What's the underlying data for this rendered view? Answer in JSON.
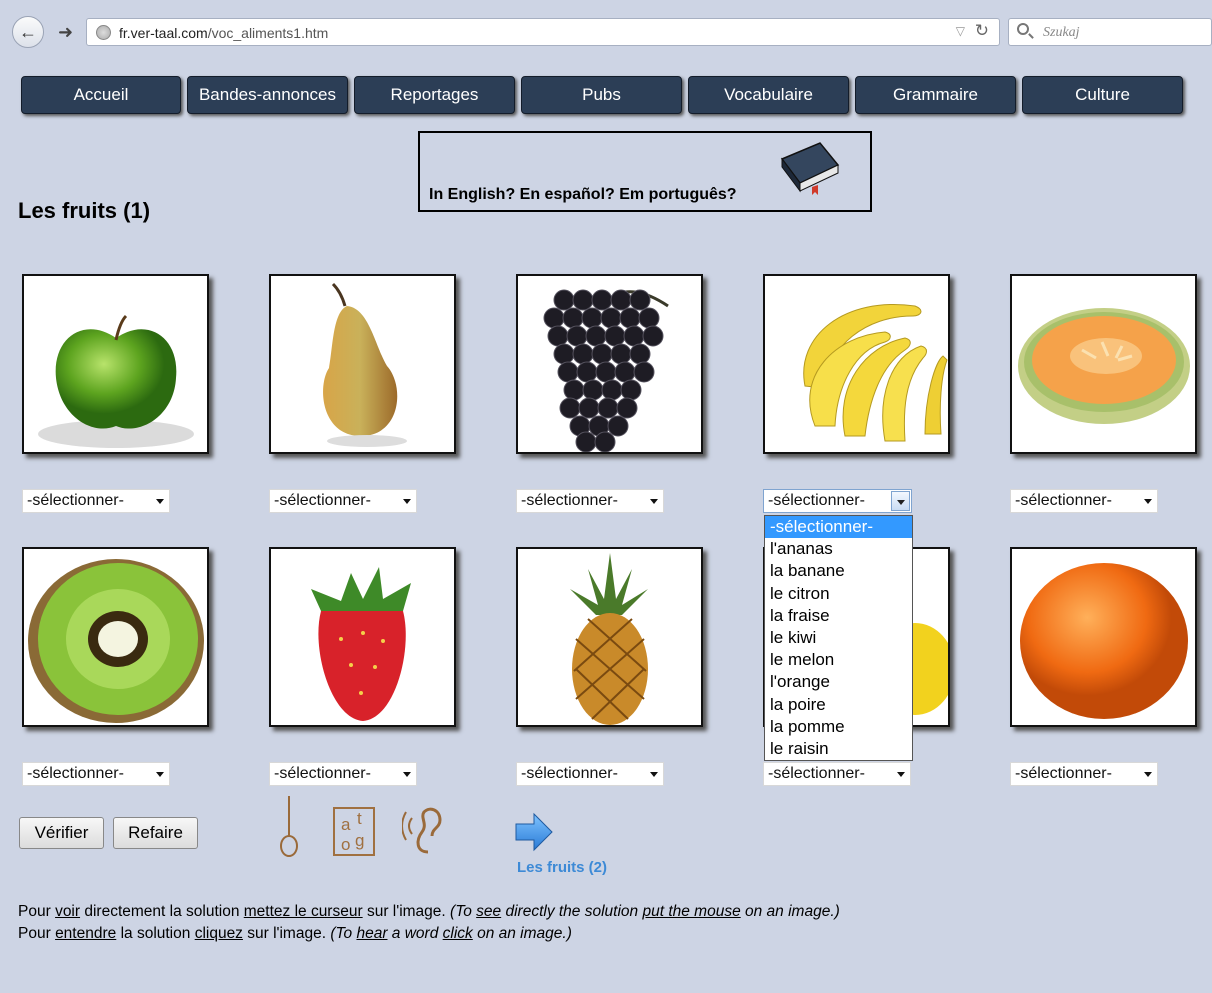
{
  "browser": {
    "url_domain": "fr.ver-taal.com",
    "url_path": "/voc_aliments1.htm",
    "search_placeholder": "Szukaj"
  },
  "menu": [
    {
      "label": "Accueil"
    },
    {
      "label": "Bandes-annonces"
    },
    {
      "label": "Reportages"
    },
    {
      "label": "Pubs"
    },
    {
      "label": "Vocabulaire"
    },
    {
      "label": "Grammaire"
    },
    {
      "label": "Culture"
    }
  ],
  "banner": {
    "text": "In English? En español? Em português?"
  },
  "page_title": "Les fruits (1)",
  "select_label": "-sélectionner-",
  "fruits": [
    {
      "icon": "apple-image"
    },
    {
      "icon": "pear-image"
    },
    {
      "icon": "grapes-image"
    },
    {
      "icon": "bananas-image"
    },
    {
      "icon": "melon-image"
    },
    {
      "icon": "kiwi-image"
    },
    {
      "icon": "strawberry-image"
    },
    {
      "icon": "pineapple-image"
    },
    {
      "icon": "lemon-image"
    },
    {
      "icon": "orange-image"
    }
  ],
  "dropdown_options": [
    "-sélectionner-",
    "l'ananas",
    "la banane",
    "le citron",
    "la fraise",
    "le kiwi",
    "le melon",
    "l'orange",
    "la poire",
    "la pomme",
    "le raisin"
  ],
  "buttons": {
    "verify": "Vérifier",
    "redo": "Refaire"
  },
  "tools": [
    {
      "icon": "hangman-icon"
    },
    {
      "icon": "letters-icon",
      "letters": [
        "a",
        "t",
        "o",
        "g"
      ]
    },
    {
      "icon": "ear-icon"
    }
  ],
  "next_link": "Les fruits (2)",
  "help": {
    "line1": {
      "a": "Pour ",
      "voir": "voir",
      "b": " directement la solution ",
      "curseur": "mettez le curseur",
      "c": " sur l'image. ",
      "i1": "(To ",
      "see": "see",
      "i2": " directly the solution ",
      "mouse": "put the mouse",
      "i3": " on an image.)"
    },
    "line2": {
      "a": "Pour ",
      "entendre": "entendre",
      "b": " la solution ",
      "cliquez": "cliquez",
      "c": " sur l'image. ",
      "i1": "(To ",
      "hear": "hear",
      "i2": " a word ",
      "click": "click",
      "i3": " on an image.)"
    }
  },
  "colors": {
    "menu_bg": "#2c3e56",
    "page_bg": "#cdd4e4",
    "link_blue": "#3d8ad6",
    "highlight": "#3399ff"
  }
}
